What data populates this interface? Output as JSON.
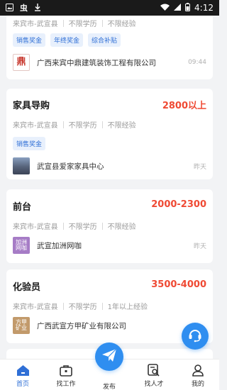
{
  "status_bar": {
    "time": "4:12"
  },
  "jobs": [
    {
      "location": "来宾市-武宣县",
      "education": "不限学历",
      "experience": "不限经验",
      "tags": [
        "销售奖金",
        "年终奖金",
        "综合补贴"
      ],
      "company": "广西来宾中鼎建筑装饰工程有限公司",
      "time": "09:44",
      "logo_text": "鼎",
      "logo_color": "#c7352b"
    },
    {
      "title": "家具导购",
      "salary": "2800以上",
      "location": "来宾市-武宣县",
      "education": "不限学历",
      "experience": "不限经验",
      "tags": [
        "销售奖金"
      ],
      "company": "武宣县爱家家具中心",
      "time": "昨天",
      "logo_text": "",
      "logo_color": "#56637a"
    },
    {
      "title": "前台",
      "salary": "2000-2300",
      "location": "来宾市-武宣县",
      "education": "不限学历",
      "experience": "不限经验",
      "company": "武宣加洲网咖",
      "time": "昨天",
      "logo_text": "加洲网咖",
      "logo_color": "#a67cc6"
    },
    {
      "title": "化验员",
      "salary": "3500-4000",
      "location": "来宾市-武宣县",
      "education": "不限学历",
      "experience": "1年以上经验",
      "company": "广西武宣方甲矿业有限公司",
      "time": "",
      "logo_text": "方甲矿业",
      "logo_color": "#c29a6b"
    }
  ],
  "tabbar": {
    "items": [
      {
        "label": "首页",
        "icon": "home-icon"
      },
      {
        "label": "找工作",
        "icon": "briefcase-icon"
      },
      {
        "label": "发布",
        "icon": "paper-plane-icon"
      },
      {
        "label": "找人才",
        "icon": "resume-search-icon"
      },
      {
        "label": "我的",
        "icon": "user-icon"
      }
    ],
    "active_color": "#2f6fd6"
  },
  "colors": {
    "salary": "#ef4a34",
    "tag_text": "#2f6fd6",
    "tag_bg": "#e8f0fc",
    "accent": "#2f8ef0"
  }
}
